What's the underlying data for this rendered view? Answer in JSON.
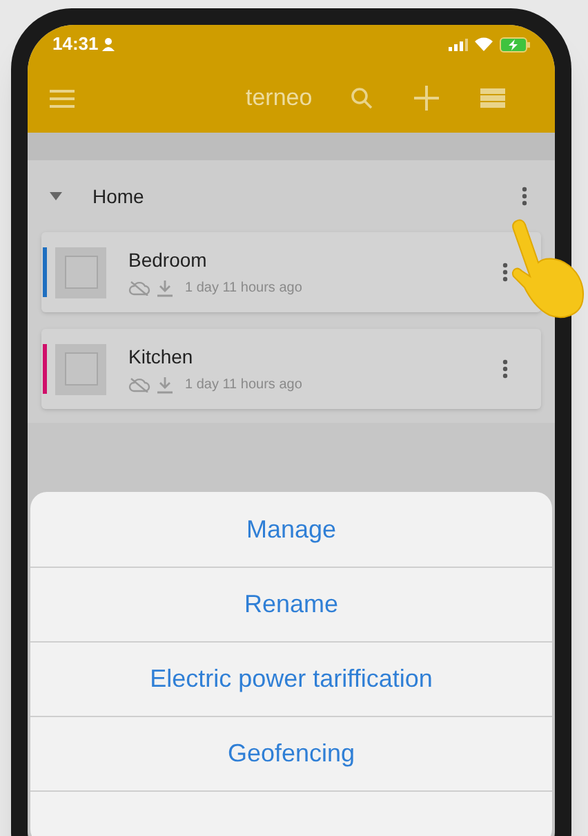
{
  "status_bar": {
    "time": "14:31"
  },
  "app_bar": {
    "title": "terneo"
  },
  "group": {
    "name": "Home",
    "expanded": true
  },
  "devices": [
    {
      "name": "Bedroom",
      "updated": "1 day 11 hours ago",
      "color": "#1f6fc0"
    },
    {
      "name": "Kitchen",
      "updated": "1 day 11 hours ago",
      "color": "#d0106a"
    }
  ],
  "action_sheet": [
    "Manage",
    "Rename",
    "Electric power tariffication",
    "Geofencing"
  ]
}
